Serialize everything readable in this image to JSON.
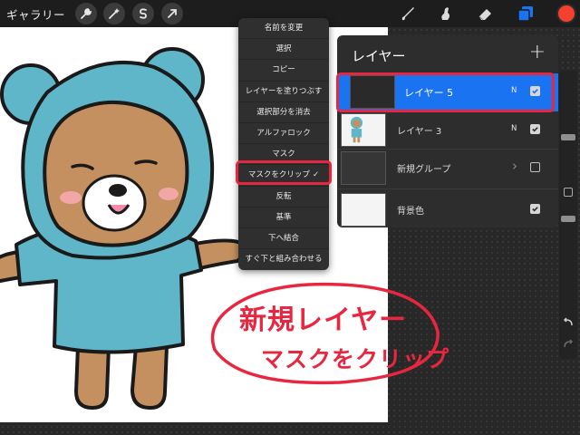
{
  "toolbar": {
    "gallery_label": "ギャラリー",
    "left_icons": [
      "wrench-icon",
      "magic-wand-icon",
      "selection-s-icon",
      "transform-arrow-icon"
    ],
    "right_icons": [
      "brush-icon",
      "smudge-icon",
      "eraser-icon",
      "layers-icon"
    ],
    "current_color": "#f4412f"
  },
  "context_menu": {
    "items": [
      {
        "label": "名前を変更"
      },
      {
        "label": "選択"
      },
      {
        "label": "コピー"
      },
      {
        "label": "レイヤーを塗りつぶす"
      },
      {
        "label": "選択部分を消去"
      },
      {
        "label": "アルファロック"
      },
      {
        "label": "マスク"
      },
      {
        "label": "マスクをクリップ",
        "checked": true,
        "check_mark": "✓"
      },
      {
        "label": "反転"
      },
      {
        "label": "基準"
      },
      {
        "label": "下へ結合"
      },
      {
        "label": "すぐ下と組み合わせる"
      }
    ]
  },
  "layers_panel": {
    "title": "レイヤー",
    "add_symbol": "+",
    "layers": [
      {
        "name": "レイヤー 5",
        "mode": "N",
        "visible": true,
        "selected": true
      },
      {
        "name": "レイヤー 3",
        "mode": "N",
        "visible": true,
        "selected": false
      },
      {
        "name": "新規グループ",
        "mode": "",
        "chevron": "›",
        "visible": false,
        "selected": false
      },
      {
        "name": "背景色",
        "mode": "",
        "visible": true,
        "selected": false
      }
    ]
  },
  "annotation": {
    "line1": "新規レイヤー",
    "line2": "マスクをクリップ"
  },
  "colors": {
    "highlight": "#e8263f",
    "active_layer": "#1a73f0",
    "bear_hood": "#5fb6c8",
    "bear_face": "#c5905f"
  }
}
